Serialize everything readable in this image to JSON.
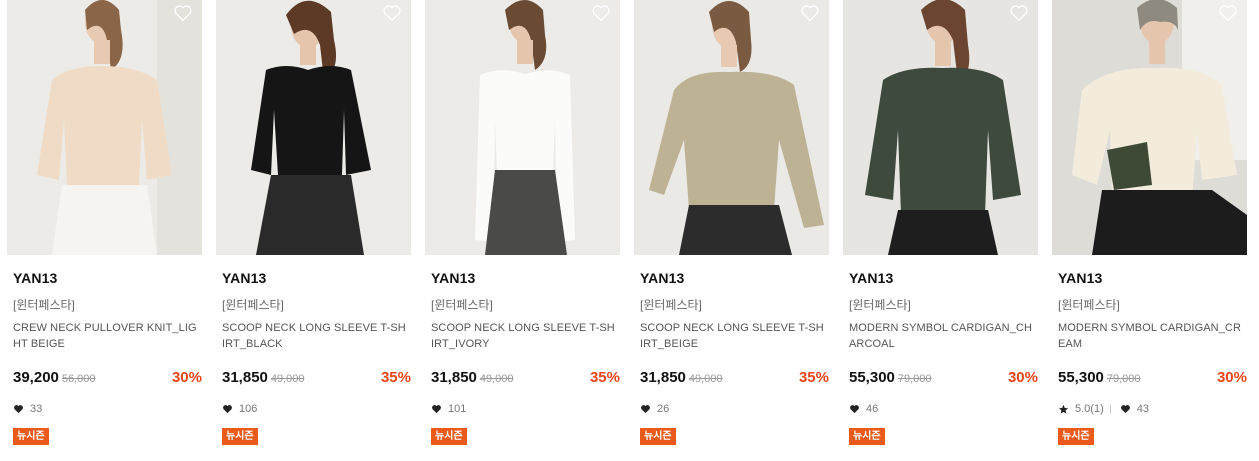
{
  "products": [
    {
      "brand": "YAN13",
      "tag": "[윈터페스타]",
      "name": "CREW NECK PULLOVER KNIT_LIGHT BEIGE",
      "price": "39,200",
      "original_price": "56,000",
      "discount": "30%",
      "likes": "33",
      "rating": null,
      "badge": "뉴시즌",
      "image_desc": "model-beige-knit"
    },
    {
      "brand": "YAN13",
      "tag": "[윈터페스타]",
      "name": "SCOOP NECK LONG SLEEVE T-SHIRT_BLACK",
      "price": "31,850",
      "original_price": "49,000",
      "discount": "35%",
      "likes": "106",
      "rating": null,
      "badge": "뉴시즌",
      "image_desc": "model-black-tshirt"
    },
    {
      "brand": "YAN13",
      "tag": "[윈터페스타]",
      "name": "SCOOP NECK LONG SLEEVE T-SHIRT_IVORY",
      "price": "31,850",
      "original_price": "49,000",
      "discount": "35%",
      "likes": "101",
      "rating": null,
      "badge": "뉴시즌",
      "image_desc": "model-ivory-tshirt"
    },
    {
      "brand": "YAN13",
      "tag": "[윈터페스타]",
      "name": "SCOOP NECK LONG SLEEVE T-SHIRT_BEIGE",
      "price": "31,850",
      "original_price": "49,000",
      "discount": "35%",
      "likes": "26",
      "rating": null,
      "badge": "뉴시즌",
      "image_desc": "model-beige-tshirt"
    },
    {
      "brand": "YAN13",
      "tag": "[윈터페스타]",
      "name": "MODERN SYMBOL CARDIGAN_CHARCOAL",
      "price": "55,300",
      "original_price": "79,000",
      "discount": "30%",
      "likes": "46",
      "rating": null,
      "badge": "뉴시즌",
      "image_desc": "model-charcoal-cardigan"
    },
    {
      "brand": "YAN13",
      "tag": "[윈터페스타]",
      "name": "MODERN SYMBOL CARDIGAN_CREAM",
      "price": "55,300",
      "original_price": "79,000",
      "discount": "30%",
      "likes": "43",
      "rating": "5.0(1)",
      "badge": "뉴시즌",
      "image_desc": "model-cream-cardigan"
    }
  ],
  "colors": {
    "discount": "#e8451c",
    "badge": "#ea5a1a"
  }
}
